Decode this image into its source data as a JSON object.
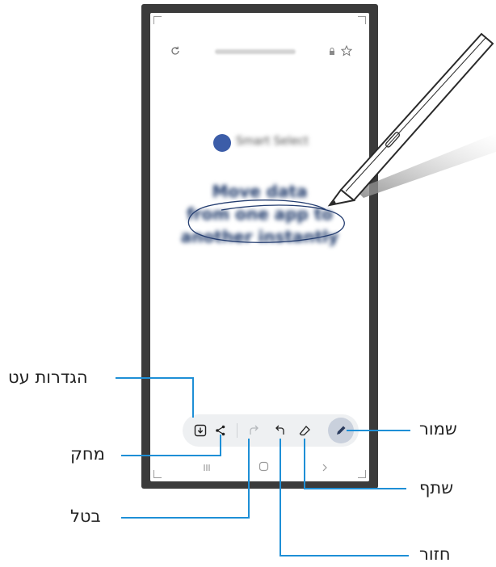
{
  "browser": {
    "refresh_icon": "refresh-icon",
    "url_text": "",
    "lock_icon": "lock-icon",
    "star_icon": "star-icon"
  },
  "content": {
    "app_badge_label": "Smart Select",
    "heading_lines": [
      "Move data",
      "from one app to",
      "another instantly"
    ]
  },
  "toolbar": {
    "buttons": [
      "save-icon",
      "share-icon",
      "redo-icon",
      "undo-icon",
      "eraser-icon",
      "pen-icon"
    ]
  },
  "callouts": {
    "pen_settings": "הגדרות עט",
    "eraser": "מחק",
    "undo": "בטל",
    "redo": "חזור",
    "save": "שמור",
    "share": "שתף"
  },
  "colors": {
    "leader_line": "#1e8fd6",
    "frame": "#3b3b3b",
    "toolbar_bg": "#eef0f2",
    "pen_button_bg": "#c9d0dc",
    "blur_text": "#1f3a6b"
  }
}
